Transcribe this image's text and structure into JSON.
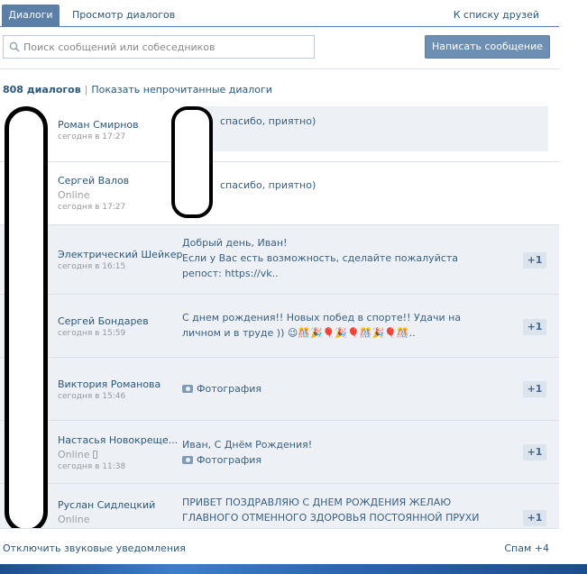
{
  "tabs": {
    "active": "Диалоги",
    "view": "Просмотр диалогов",
    "friends": "К списку друзей"
  },
  "search": {
    "placeholder": "Поиск сообщений или собеседников"
  },
  "write_button": "Написать сообщение",
  "summary": {
    "count": "808 диалогов",
    "separator": "|",
    "unread_link": "Показать непрочитанные диалоги"
  },
  "dialogs": [
    {
      "name": "Роман Смирнов",
      "online": "",
      "time": "сегодня в 17:27",
      "message": "спасибо, приятно)",
      "badge": ""
    },
    {
      "name": "Сергей Валов",
      "online": "Online",
      "time": "сегодня в 17:27",
      "message": "спасибо, приятно)",
      "badge": ""
    },
    {
      "name": "Электрический Шейкер",
      "online": "",
      "time": "сегодня в 16:15",
      "message_lines": [
        "Добрый день, Иван!",
        "Если у Вас есть возможность, сделайте пожалуйста",
        "репост: https://vk.."
      ],
      "badge": "+1"
    },
    {
      "name": "Сергей Бондарев",
      "online": "",
      "time": "сегодня в 15:59",
      "message_lines": [
        "С днем рождения!! Новых побед в спорте!! Удачи на",
        "личном и в труде ))"
      ],
      "emoji_tail": "😉🎊🎉🎈🎉🎈🎊🎉🎈🎊..",
      "badge": "+1"
    },
    {
      "name": "Виктория Романова",
      "online": "",
      "time": "сегодня в 15:46",
      "attachment": "Фотография",
      "badge": "+1"
    },
    {
      "name": "Настасья Новокреще...",
      "online": "Online",
      "time": "сегодня в 11:38",
      "message": "Иван, С Днём Рождения!",
      "attachment": "Фотография",
      "badge": "+1"
    },
    {
      "name": "Руслан Сидлецкий",
      "online": "Online",
      "time": "",
      "message_lines": [
        "ПРИВЕТ ПОЗДРАВЛЯЮ С ДНЕМ РОЖДЕНИЯ ЖЕЛАЮ",
        "ГЛАВНОГО ОТМЕННОГО ЗДОРОВЬЯ ПОСТОЯННОЙ ПРУХИ"
      ],
      "badge": "+1"
    }
  ],
  "footer": {
    "sound_toggle": "Отключить звуковые уведомления",
    "spam": "Спам +4"
  },
  "colors": {
    "accent": "#5b7fa6",
    "link": "#2b587a",
    "unread_bg": "#edf1f5",
    "badge_bg": "#dbe3ec"
  },
  "icons": {
    "search": "search-icon",
    "photo": "photo-icon",
    "mobile": "phone-icon"
  }
}
